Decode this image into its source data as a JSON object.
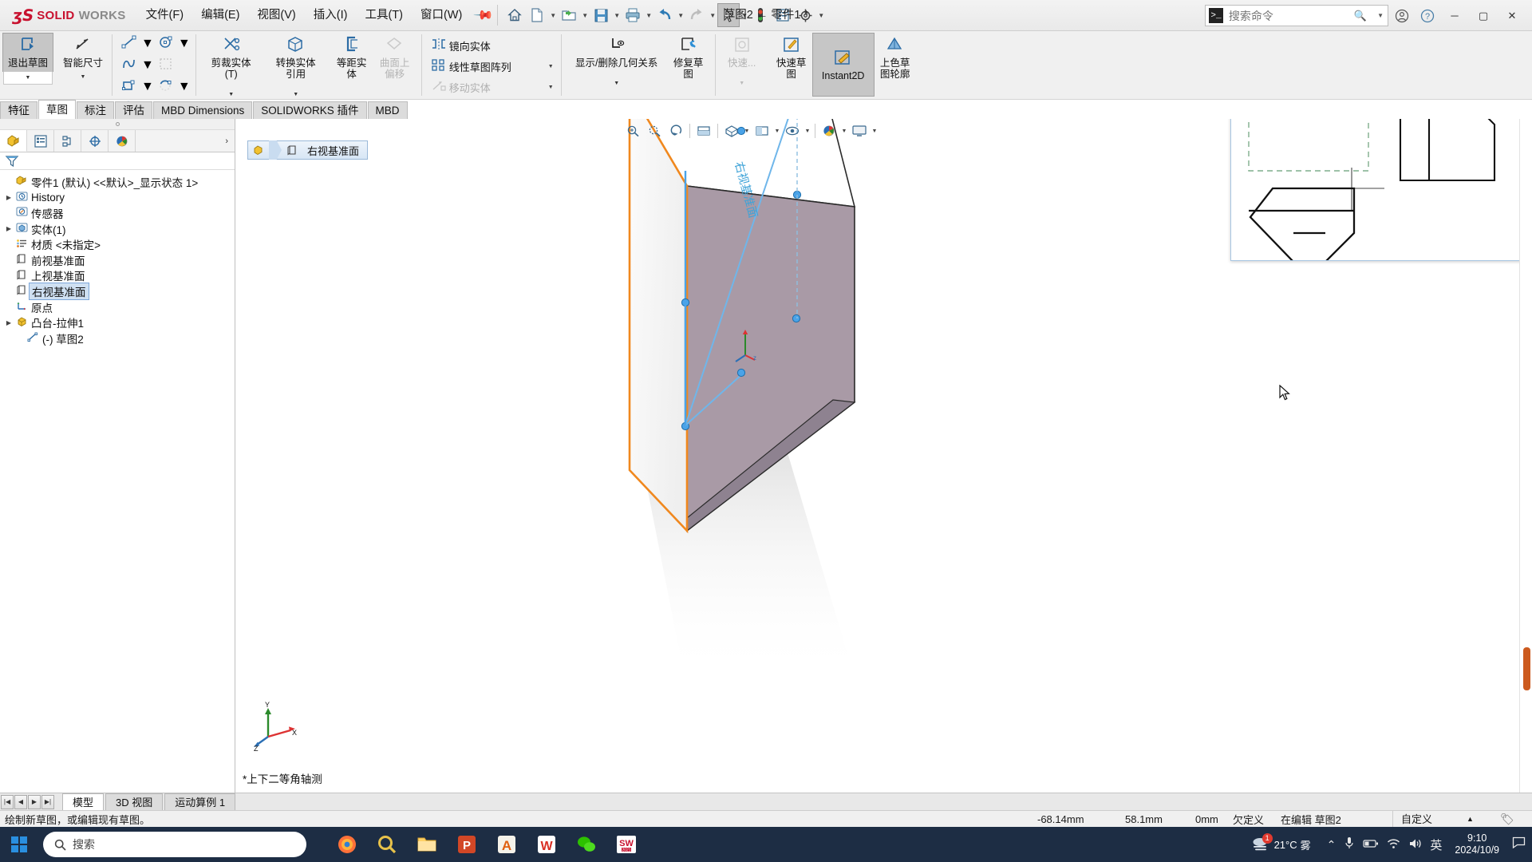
{
  "app": {
    "brand_ds": "ʒS",
    "brand_solid": "SOLID",
    "brand_works": "WORKS",
    "doc_title": "草图2 ← 零件1 *"
  },
  "menu": {
    "items": [
      {
        "label": "文件(F)"
      },
      {
        "label": "编辑(E)"
      },
      {
        "label": "视图(V)"
      },
      {
        "label": "插入(I)"
      },
      {
        "label": "工具(T)"
      },
      {
        "label": "窗口(W)"
      }
    ],
    "pin_icon": "pushpin-icon"
  },
  "quick_access": [
    {
      "name": "home-icon",
      "glyph": "⌂",
      "caret": false
    },
    {
      "name": "new-document-icon",
      "glyph": "🗋",
      "caret": true
    },
    {
      "name": "open-folder-icon",
      "glyph": "📂",
      "caret": true
    },
    {
      "name": "save-icon",
      "glyph": "💾",
      "caret": true
    },
    {
      "name": "print-icon",
      "glyph": "🖶",
      "caret": true
    },
    {
      "name": "undo-icon",
      "glyph": "↩",
      "caret": true
    },
    {
      "name": "redo-icon",
      "glyph": "↪",
      "caret": true
    },
    {
      "name": "select-arrow-icon",
      "glyph": "➤",
      "caret": true
    },
    {
      "name": "rebuild-icon",
      "glyph": "🚦",
      "caret": false
    },
    {
      "name": "options-list-icon",
      "glyph": "▤",
      "caret": false
    },
    {
      "name": "settings-gear-icon",
      "glyph": "⚙",
      "caret": true
    }
  ],
  "search": {
    "placeholder": "搜索命令",
    "prompt": ">_"
  },
  "header_right": [
    {
      "name": "account-icon",
      "glyph": "☺"
    },
    {
      "name": "help-icon",
      "glyph": "?"
    }
  ],
  "window_buttons": [
    {
      "name": "minimize-button",
      "glyph": "─"
    },
    {
      "name": "maximize-button",
      "glyph": "▢"
    },
    {
      "name": "close-button",
      "glyph": "✕"
    }
  ],
  "ribbon": {
    "exit_sketch": {
      "label": "退出草图",
      "icon": "exit-sketch-icon"
    },
    "smart_dimension": {
      "label": "智能尺寸",
      "icon": "smart-dimension-icon"
    },
    "sketch_entities": [
      {
        "name": "line-icon",
        "glyph": "╱",
        "caret": true
      },
      {
        "name": "circle-icon",
        "glyph": "◎",
        "caret": true
      },
      {
        "name": "spline-icon",
        "glyph": "∿",
        "caret": true
      },
      {
        "name": "trim-pattern-icon",
        "glyph": "▦",
        "caret": false
      },
      {
        "name": "rectangle-icon",
        "glyph": "▭",
        "caret": true
      },
      {
        "name": "arc-icon",
        "glyph": "◜",
        "caret": true
      },
      {
        "name": "ellipse-icon",
        "glyph": "⬭",
        "caret": true
      },
      {
        "name": "text-icon",
        "glyph": "A",
        "caret": false
      },
      {
        "name": "slot-icon",
        "glyph": "⬯",
        "caret": true
      },
      {
        "name": "polygon-icon",
        "glyph": "⬡",
        "caret": false
      },
      {
        "name": "fillet-icon",
        "glyph": "⌐",
        "caret": true
      },
      {
        "name": "point-icon",
        "glyph": "▪",
        "caret": false
      }
    ],
    "tools": [
      {
        "label": "剪裁实体(T)",
        "icon": "trim-entities-icon",
        "caret": true,
        "disabled": false
      },
      {
        "label": "转换实体引用",
        "icon": "convert-entities-icon",
        "caret": true,
        "disabled": false
      },
      {
        "label": "等距实体",
        "icon": "offset-entities-icon",
        "caret": false,
        "disabled": false
      },
      {
        "label": "曲面上偏移",
        "icon": "offset-on-surface-icon",
        "caret": false,
        "disabled": true
      }
    ],
    "pattern_rows": [
      {
        "label": "镜向实体",
        "icon": "mirror-entities-icon",
        "caret": false,
        "disabled": false
      },
      {
        "label": "线性草图阵列",
        "icon": "linear-sketch-pattern-icon",
        "caret": true,
        "disabled": false
      },
      {
        "label": "移动实体",
        "icon": "move-entities-icon",
        "caret": true,
        "disabled": true
      }
    ],
    "relations": {
      "label": "显示/删除几何关系",
      "icon": "display-delete-relations-icon"
    },
    "repair": {
      "label": "修复草图",
      "icon": "repair-sketch-icon"
    },
    "quick_sketch_disabled": {
      "label": "快速...",
      "icon": "quick-snaps-icon"
    },
    "rapid_sketch": {
      "label": "快速草图",
      "icon": "rapid-sketch-icon"
    },
    "instant2d": {
      "label": "Instant2D",
      "icon": "instant2d-icon"
    },
    "shaded_contour": {
      "label": "上色草图轮廓",
      "icon": "shaded-sketch-contours-icon"
    }
  },
  "command_tabs": [
    {
      "label": "特征",
      "active": false
    },
    {
      "label": "草图",
      "active": true
    },
    {
      "label": "标注",
      "active": false
    },
    {
      "label": "评估",
      "active": false
    },
    {
      "label": "MBD Dimensions",
      "active": false
    },
    {
      "label": "SOLIDWORKS 插件",
      "active": false
    },
    {
      "label": "MBD",
      "active": false
    }
  ],
  "tree_tabs": [
    {
      "name": "feature-manager-tab",
      "glyph": "🧩",
      "active": true
    },
    {
      "name": "property-manager-tab",
      "glyph": "▤",
      "active": false
    },
    {
      "name": "configuration-manager-tab",
      "glyph": "⎅",
      "active": false
    },
    {
      "name": "dimxpert-manager-tab",
      "glyph": "⊕",
      "active": false
    },
    {
      "name": "display-manager-tab",
      "glyph": "◕",
      "active": false
    }
  ],
  "filter": {
    "icon": "filter-funnel-icon"
  },
  "tree": {
    "root": {
      "label": "零件1 (默认) <<默认>_显示状态 1>",
      "icon": "part-icon"
    },
    "items": [
      {
        "label": "History",
        "icon": "history-icon",
        "expand": true,
        "indent": 0,
        "selected": false
      },
      {
        "label": "传感器",
        "icon": "sensors-icon",
        "expand": false,
        "indent": 0,
        "selected": false
      },
      {
        "label": "实体(1)",
        "icon": "solid-bodies-icon",
        "expand": true,
        "indent": 0,
        "selected": false
      },
      {
        "label": "材质 <未指定>",
        "icon": "material-icon",
        "expand": false,
        "indent": 0,
        "selected": false
      },
      {
        "label": "前视基准面",
        "icon": "plane-icon",
        "expand": false,
        "indent": 0,
        "selected": false
      },
      {
        "label": "上视基准面",
        "icon": "plane-icon",
        "expand": false,
        "indent": 0,
        "selected": false
      },
      {
        "label": "右视基准面",
        "icon": "plane-icon",
        "expand": false,
        "indent": 0,
        "selected": true
      },
      {
        "label": "原点",
        "icon": "origin-icon",
        "expand": false,
        "indent": 0,
        "selected": false
      },
      {
        "label": "凸台-拉伸1",
        "icon": "boss-extrude-icon",
        "expand": true,
        "indent": 0,
        "selected": false
      },
      {
        "label": "(-) 草图2",
        "icon": "sketch-icon",
        "expand": false,
        "indent": 1,
        "selected": false
      }
    ]
  },
  "view_toolbar": [
    {
      "name": "zoom-to-fit-icon",
      "glyph": "⌕",
      "caret": false
    },
    {
      "name": "zoom-to-area-icon",
      "glyph": "⊕",
      "caret": false
    },
    {
      "name": "previous-view-icon",
      "glyph": "↺",
      "caret": false
    },
    {
      "name": "section-view-icon",
      "glyph": "⬒",
      "caret": false
    },
    {
      "name": "view-orientation-icon",
      "glyph": "⬕",
      "caret": true
    },
    {
      "name": "display-style-icon",
      "glyph": "◧",
      "caret": true
    },
    {
      "name": "hide-show-items-icon",
      "glyph": "👁",
      "caret": true
    },
    {
      "name": "appearances-icon",
      "glyph": "◔",
      "caret": true
    },
    {
      "name": "scene-icon",
      "glyph": "🖵",
      "caret": true
    }
  ],
  "graphics": {
    "plane_badge": {
      "label": "右视基准面",
      "icon": "plane-badge-icon"
    },
    "plane_label_3d": "右视基准面",
    "view_name": "*上下二等角轴测",
    "triad": {
      "x": "X",
      "y": "Y",
      "z": "Z"
    }
  },
  "bottom_tabs": {
    "nav": [
      {
        "name": "first-tab-button",
        "glyph": "|◀"
      },
      {
        "name": "prev-tab-button",
        "glyph": "◀"
      },
      {
        "name": "next-tab-button",
        "glyph": "▶"
      },
      {
        "name": "last-tab-button",
        "glyph": "▶|"
      }
    ],
    "tabs": [
      {
        "label": "模型",
        "active": true
      },
      {
        "label": "3D 视图",
        "active": false
      },
      {
        "label": "运动算例 1",
        "active": false
      }
    ]
  },
  "status": {
    "message": "绘制新草图，或编辑现有草图。",
    "x": "-68.14mm",
    "y": "58.1mm",
    "z": "0mm",
    "state": "欠定义",
    "editing": "在编辑 草图2",
    "custom": "自定义",
    "caret": "▲",
    "icon": "status-tag-icon"
  },
  "taskbar": {
    "start": {
      "name": "start-button",
      "glyph": "⊞"
    },
    "search_placeholder": "搜索",
    "search_icon": "search-icon",
    "apps": [
      {
        "name": "firefox-taskbar-icon",
        "glyph": "🦊",
        "color": "#ff7139"
      },
      {
        "name": "search-taskbar-icon",
        "glyph": "🔍",
        "color": "#e8c24a"
      },
      {
        "name": "file-explorer-taskbar-icon",
        "glyph": "🗂",
        "color": "#ffd166"
      },
      {
        "name": "powerpoint-taskbar-icon",
        "glyph": "P",
        "color": "#d24726"
      },
      {
        "name": "ai-app-taskbar-icon",
        "glyph": "A",
        "color": "#e06010"
      },
      {
        "name": "wps-taskbar-icon",
        "glyph": "W",
        "color": "#d93025"
      },
      {
        "name": "wechat-taskbar-icon",
        "glyph": "💬",
        "color": "#2dc100"
      },
      {
        "name": "solidworks-taskbar-icon",
        "glyph": "SW",
        "color": "#c8102e"
      }
    ],
    "weather": {
      "temp": "21°C",
      "cond": "雾",
      "icon": "fog-weather-icon",
      "badge": "1"
    },
    "tray": [
      {
        "name": "show-hidden-icons",
        "glyph": "⌃"
      },
      {
        "name": "microphone-icon",
        "glyph": "🎤"
      },
      {
        "name": "battery-icon",
        "glyph": "🔋"
      },
      {
        "name": "wifi-icon",
        "glyph": "📶"
      },
      {
        "name": "volume-icon",
        "glyph": "🔊"
      },
      {
        "name": "ime-language-indicator",
        "glyph": "英"
      }
    ],
    "time": "9:10",
    "date": "2024/10/9",
    "notification": {
      "name": "notification-center-icon",
      "glyph": "▢"
    }
  },
  "colors": {
    "accent": "#c8102e",
    "sketch_blue": "#2c6ca5",
    "selection": "#cfe0f2",
    "taskbar": "#1d2d44",
    "scroll_thumb": "#cc5a1e",
    "edge_orange": "#f0881e"
  }
}
